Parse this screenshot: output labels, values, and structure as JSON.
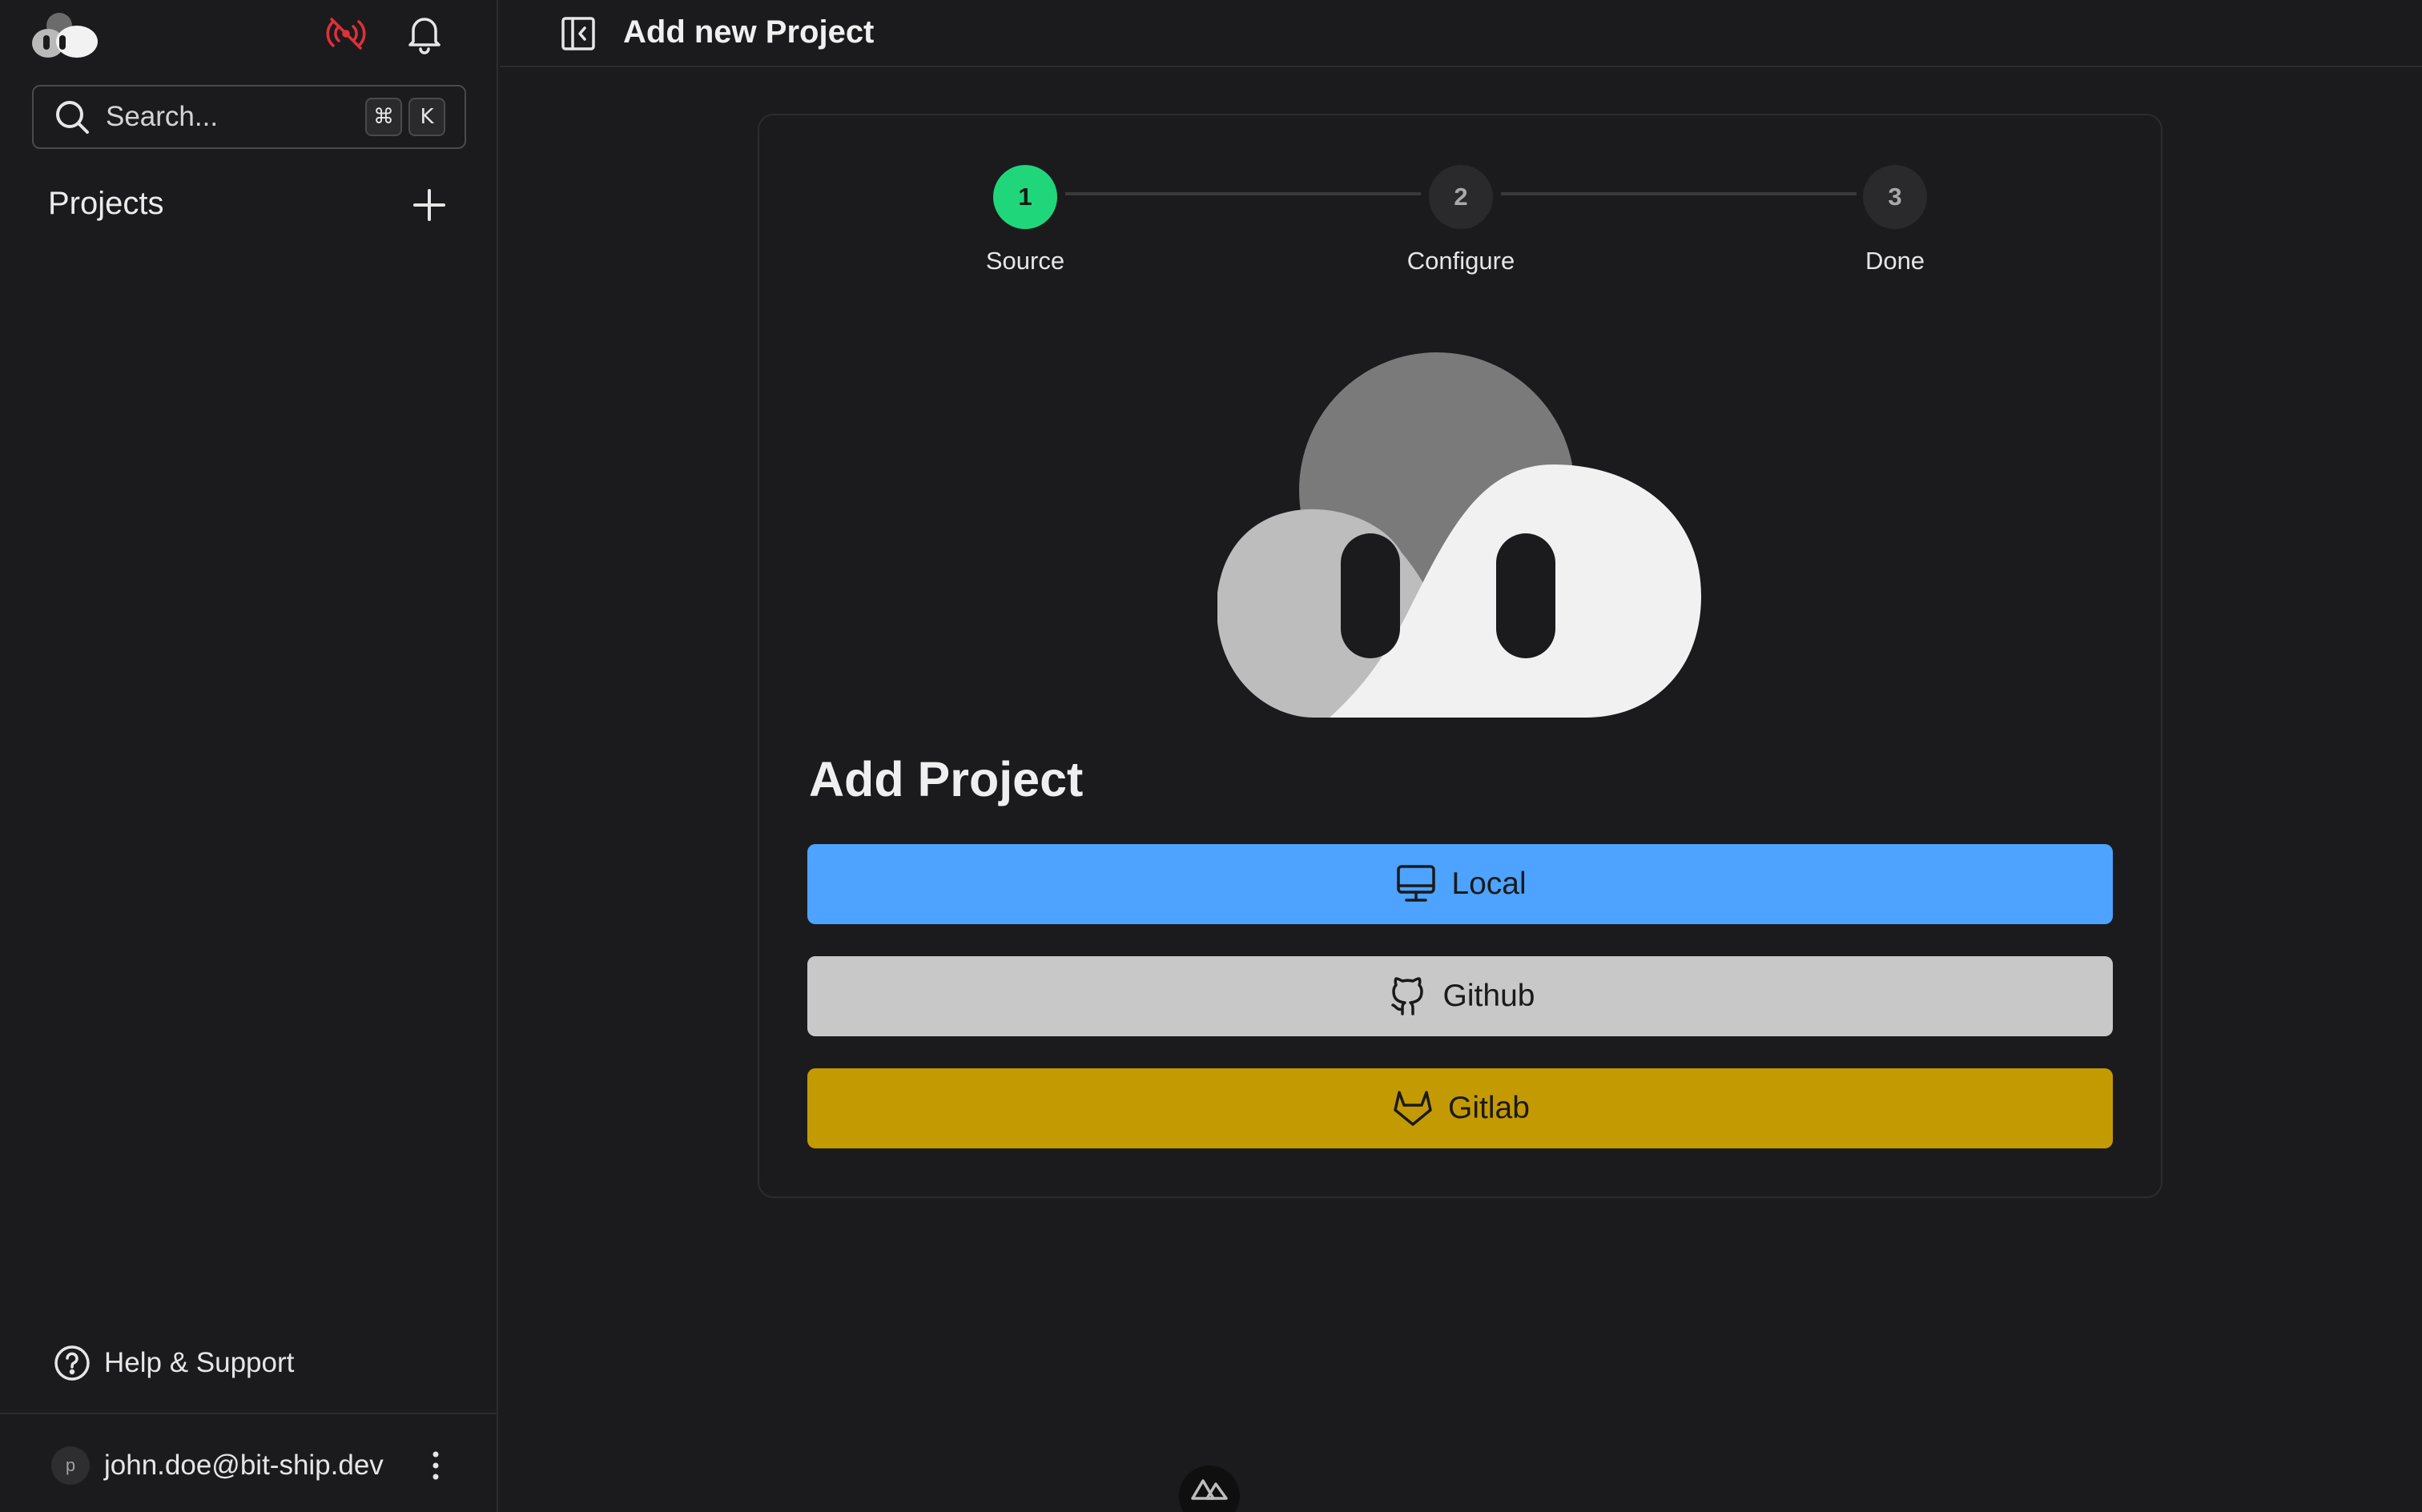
{
  "sidebar": {
    "search": {
      "placeholder": "Search...",
      "shortcut_mod": "⌘",
      "shortcut_key": "K"
    },
    "projects_label": "Projects",
    "help_label": "Help & Support",
    "user": {
      "avatar_initial": "p",
      "email": "john.doe@bit-ship.dev"
    },
    "icons": [
      "app-logo",
      "live-status-icon",
      "bell-icon",
      "search-icon",
      "plus-icon",
      "help-circle-icon",
      "kebab-menu-icon"
    ],
    "live_icon_color": "#e0303a"
  },
  "header": {
    "title": "Add new Project"
  },
  "stepper": {
    "steps": [
      {
        "number": "1",
        "label": "Source",
        "state": "active"
      },
      {
        "number": "2",
        "label": "Configure",
        "state": "inactive"
      },
      {
        "number": "3",
        "label": "Done",
        "state": "inactive"
      }
    ],
    "active_color": "#20d67a"
  },
  "card": {
    "title": "Add Project",
    "buttons": [
      {
        "label": "Local",
        "icon": "monitor-icon",
        "color": "#4da3ff"
      },
      {
        "label": "Github",
        "icon": "github-icon",
        "color": "#c8c8c8"
      },
      {
        "label": "Gitlab",
        "icon": "gitlab-icon",
        "color": "#c49a02"
      }
    ]
  },
  "footer": {
    "badge_icon": "nuxt-devtools-icon"
  }
}
